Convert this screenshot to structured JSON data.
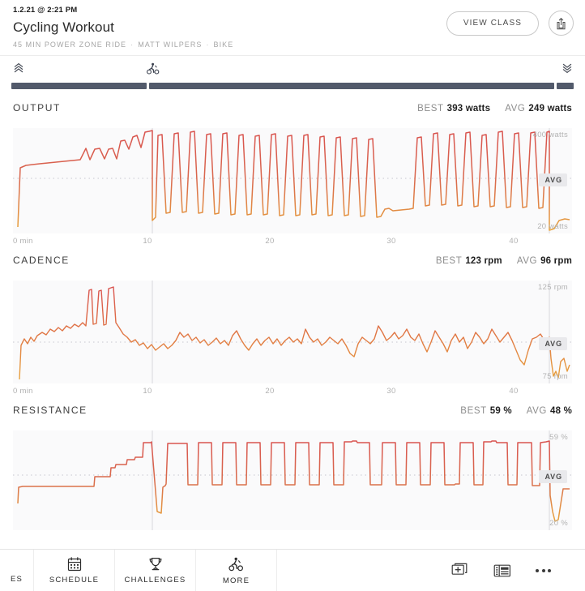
{
  "header": {
    "timestamp": "1.2.21 @ 2:21 PM",
    "title": "Cycling Workout",
    "subtitle_parts": [
      "45 MIN POWER ZONE RIDE",
      "MATT WILPERS",
      "BIKE"
    ],
    "separator": "·",
    "view_class_label": "VIEW CLASS",
    "share_icon": "share-icon"
  },
  "scrubber": {
    "left_icon": "chevrons-up-icon",
    "rider_icon": "cyclist-icon",
    "right_icon": "chevrons-down-icon",
    "progress_percent": 24
  },
  "sections": [
    {
      "name": "OUTPUT",
      "best_label": "BEST",
      "best_value": "393 watts",
      "avg_label": "AVG",
      "avg_value": "249 watts",
      "y_top": "400 watts",
      "y_bottom": "20 watts",
      "avg_pill": "AVG",
      "x_ticks": [
        "0 min",
        "10",
        "20",
        "30",
        "40"
      ]
    },
    {
      "name": "CADENCE",
      "best_label": "BEST",
      "best_value": "123 rpm",
      "avg_label": "AVG",
      "avg_value": "96 rpm",
      "y_top": "125 rpm",
      "y_bottom": "75 rpm",
      "avg_pill": "AVG",
      "x_ticks": [
        "0 min",
        "10",
        "20",
        "30",
        "40"
      ]
    },
    {
      "name": "RESISTANCE",
      "best_label": "BEST",
      "best_value": "59 %",
      "avg_label": "AVG",
      "avg_value": "48 %",
      "y_top": "59 %",
      "y_bottom": "20 %",
      "avg_pill": "AVG",
      "x_ticks": [
        "0 min",
        "10",
        "20",
        "30",
        "40"
      ]
    }
  ],
  "bottom_nav": {
    "clipped_label": "ES",
    "items": [
      {
        "label": "SCHEDULE",
        "icon": "calendar-icon"
      },
      {
        "label": "CHALLENGES",
        "icon": "trophy-icon"
      },
      {
        "label": "MORE",
        "icon": "cyclist-icon"
      }
    ],
    "right_icons": [
      "add-to-stack-icon",
      "news-icon",
      "overflow-menu-icon"
    ]
  },
  "colors": {
    "line_high": "#d9534f",
    "line_low": "#e8a33d",
    "track": "#525a6b",
    "chart_bg": "#fafafb"
  },
  "chart_data": [
    {
      "type": "line",
      "title": "OUTPUT",
      "ylabel": "watts",
      "xlabel": "min",
      "ylim": [
        20,
        400
      ],
      "xlim": [
        0,
        45
      ],
      "grid": false,
      "avg_line": 249,
      "best": 393,
      "avg": 249,
      "x": [
        0,
        0.4,
        0.9,
        1.6,
        2.4,
        3.3,
        4.2,
        5.1,
        6.0,
        6.9,
        7.4,
        7.7,
        8.1,
        8.5,
        8.9,
        9.2,
        9.5,
        9.8,
        10.1,
        10.4,
        10.7,
        11.0,
        11.3,
        11.6,
        11.9,
        12.4,
        12.9,
        13.4,
        13.9,
        14.4,
        14.9,
        15.4,
        15.9,
        16.4,
        16.9,
        17.4,
        17.9,
        18.4,
        18.9,
        19.4,
        19.9,
        20.4,
        20.9,
        21.4,
        21.9,
        22.4,
        22.9,
        23.4,
        23.9,
        24.4,
        24.9,
        25.4,
        25.9,
        26.4,
        26.9,
        27.4,
        27.9,
        28.4,
        28.9,
        29.4,
        29.9,
        30.4,
        30.9,
        31.4,
        31.9,
        32.4,
        32.9,
        33.4,
        33.9,
        34.4,
        34.9,
        35.4,
        35.9,
        36.4,
        36.9,
        37.4,
        37.9,
        38.4,
        38.9,
        39.4,
        39.9,
        40.4,
        40.9,
        41.4,
        41.9,
        42.4,
        42.9,
        43.2,
        43.6,
        44.0,
        44.5,
        45.0
      ],
      "y": [
        30,
        150,
        160,
        165,
        170,
        172,
        174,
        176,
        178,
        180,
        255,
        180,
        250,
        255,
        185,
        250,
        255,
        185,
        300,
        305,
        250,
        320,
        330,
        260,
        350,
        355,
        360,
        40,
        50,
        385,
        120,
        390,
        130,
        385,
        125,
        380,
        120,
        385,
        130,
        390,
        120,
        385,
        115,
        370,
        110,
        365,
        115,
        370,
        110,
        365,
        105,
        360,
        110,
        365,
        105,
        180,
        90,
        85,
        90,
        330,
        355,
        120,
        350,
        115,
        345,
        110,
        340,
        105,
        335,
        110,
        340,
        105,
        380,
        385,
        120,
        375,
        380,
        115,
        370,
        375,
        110,
        365,
        370,
        105,
        360,
        365,
        110,
        380,
        40,
        25,
        30,
        45
      ],
      "annotations": [
        "400 watts",
        "20 watts",
        "AVG"
      ]
    },
    {
      "type": "line",
      "title": "CADENCE",
      "ylabel": "rpm",
      "xlabel": "min",
      "ylim": [
        75,
        125
      ],
      "xlim": [
        0,
        45
      ],
      "grid": false,
      "avg_line": 96,
      "best": 123,
      "avg": 96,
      "x": [
        0,
        0.3,
        0.8,
        1.4,
        2.0,
        2.6,
        3.2,
        3.8,
        4.4,
        5.0,
        5.6,
        6.2,
        6.6,
        6.9,
        7.2,
        7.5,
        7.8,
        8.1,
        8.4,
        8.7,
        9.0,
        9.3,
        9.6,
        10.0,
        10.6,
        11.2,
        11.8,
        12.4,
        13.0,
        13.6,
        14.2,
        14.8,
        15.4,
        16.0,
        16.6,
        17.2,
        17.8,
        18.4,
        19.0,
        19.6,
        20.2,
        20.8,
        21.4,
        22.0,
        22.6,
        23.2,
        23.8,
        24.4,
        25.0,
        25.6,
        26.2,
        26.8,
        27.4,
        28.0,
        28.6,
        29.2,
        29.8,
        30.4,
        31.0,
        31.6,
        32.2,
        32.8,
        33.4,
        34.0,
        34.6,
        35.2,
        35.8,
        36.4,
        37.0,
        37.6,
        38.2,
        38.8,
        39.4,
        40.0,
        40.6,
        41.2,
        41.8,
        42.4,
        43.0,
        43.4,
        43.8,
        44.2,
        44.6,
        45.0
      ],
      "y": [
        75,
        95,
        97,
        99,
        101,
        100,
        102,
        104,
        103,
        104,
        105,
        103,
        122,
        96,
        121,
        96,
        120,
        97,
        123,
        121,
        100,
        99,
        98,
        97,
        93,
        95,
        94,
        92,
        95,
        94,
        93,
        96,
        95,
        100,
        99,
        97,
        98,
        96,
        97,
        95,
        96,
        94,
        95,
        92,
        93,
        95,
        96,
        94,
        92,
        95,
        94,
        97,
        95,
        93,
        96,
        98,
        96,
        95,
        97,
        95,
        93,
        96,
        99,
        97,
        95,
        96,
        94,
        95,
        97,
        96,
        94,
        97,
        95,
        93,
        92,
        96,
        97,
        95,
        88,
        84,
        96,
        78,
        86,
        82
      ],
      "annotations": [
        "125 rpm",
        "75 rpm",
        "AVG"
      ]
    },
    {
      "type": "line",
      "title": "RESISTANCE",
      "ylabel": "%",
      "xlabel": "min",
      "ylim": [
        20,
        59
      ],
      "xlim": [
        0,
        45
      ],
      "grid": false,
      "avg_line": 48,
      "best": 59,
      "avg": 48,
      "x": [
        0,
        0.4,
        0.8,
        6.5,
        6.8,
        7.8,
        8.1,
        8.6,
        8.9,
        9.3,
        9.6,
        10.0,
        10.3,
        10.6,
        11.0,
        11.4,
        11.8,
        12.2,
        12.6,
        13.0,
        13.4,
        13.8,
        14.4,
        15.0,
        15.6,
        16.2,
        16.8,
        17.4,
        18.0,
        18.6,
        19.2,
        19.8,
        20.4,
        21.0,
        21.6,
        22.2,
        22.8,
        23.4,
        24.0,
        24.6,
        25.2,
        25.8,
        26.4,
        27.0,
        27.6,
        28.2,
        28.8,
        29.4,
        30.0,
        30.6,
        31.2,
        31.8,
        32.4,
        33.0,
        33.6,
        34.2,
        34.8,
        35.4,
        36.0,
        36.6,
        37.2,
        37.8,
        38.4,
        39.0,
        39.6,
        40.2,
        40.8,
        41.4,
        42.0,
        42.6,
        43.0,
        43.4,
        43.8,
        44.2,
        44.6,
        45.0
      ],
      "y": [
        26,
        35,
        35,
        35,
        38,
        38,
        44,
        44,
        46,
        46,
        48,
        48,
        52,
        52,
        57,
        57,
        30,
        22,
        34,
        34,
        58,
        58,
        34,
        34,
        57,
        57,
        34,
        34,
        57,
        57,
        34,
        34,
        57,
        57,
        34,
        34,
        57,
        57,
        34,
        34,
        57,
        57,
        34,
        40,
        40,
        57,
        57,
        40,
        40,
        58,
        58,
        40,
        40,
        57,
        57,
        40,
        40,
        57,
        57,
        28,
        28,
        28,
        50,
        50,
        28,
        57,
        57,
        28,
        57,
        57,
        28,
        57,
        57,
        59,
        22,
        38
      ],
      "annotations": [
        "59 %",
        "20 %",
        "AVG"
      ]
    }
  ]
}
